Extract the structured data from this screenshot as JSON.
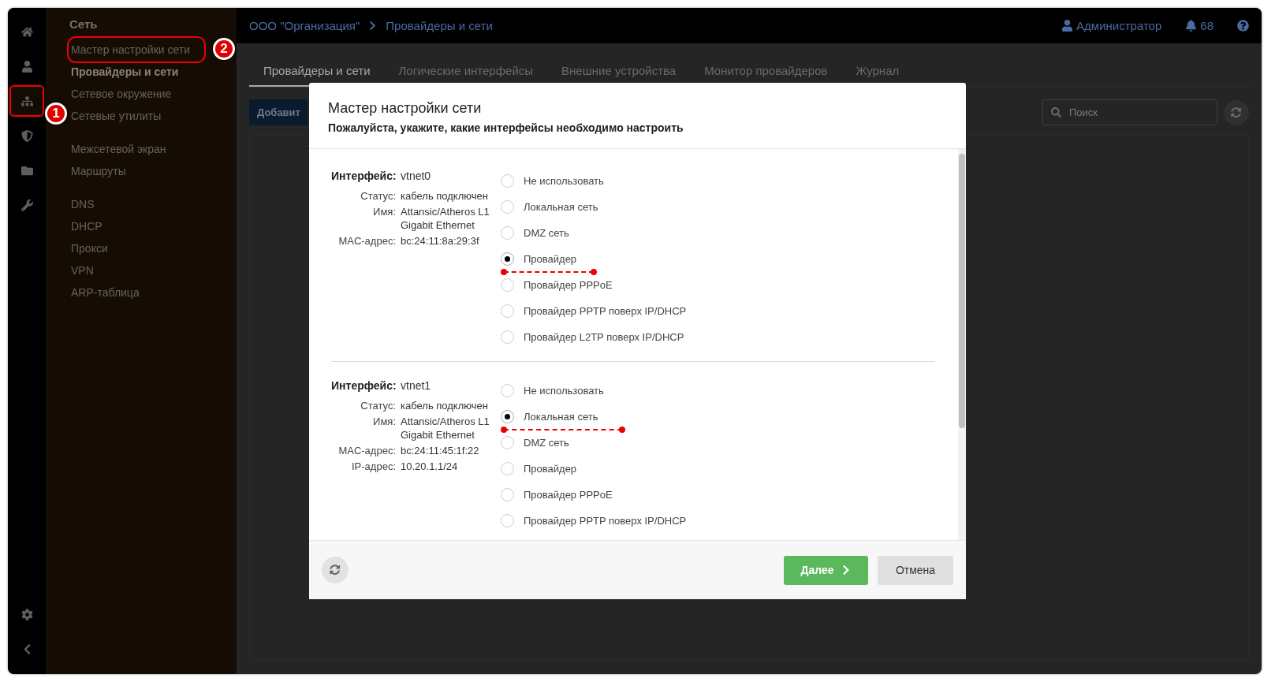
{
  "rail": {
    "items": [
      {
        "selected": false
      },
      {
        "selected": false
      },
      {
        "selected": true,
        "marker": "1"
      },
      {
        "selected": false
      },
      {
        "selected": false
      },
      {
        "selected": false
      }
    ],
    "bottom_items": [
      {
        "selected": false
      },
      {
        "selected": false
      }
    ]
  },
  "sidebar": {
    "title": "Сеть",
    "groups": [
      [
        {
          "label": "Мастер настройки сети",
          "selected": false,
          "marker": "2"
        },
        {
          "label": "Провайдеры и сети",
          "selected": true
        },
        {
          "label": "Сетевое окружение",
          "selected": false
        },
        {
          "label": "Сетевые утилиты",
          "selected": false
        }
      ],
      [
        {
          "label": "Межсетевой экран",
          "selected": false
        },
        {
          "label": "Маршруты",
          "selected": false
        }
      ],
      [
        {
          "label": "DNS",
          "selected": false
        },
        {
          "label": "DHCP",
          "selected": false
        },
        {
          "label": "Прокси",
          "selected": false
        },
        {
          "label": "VPN",
          "selected": false
        },
        {
          "label": "ARP-таблица",
          "selected": false
        }
      ]
    ]
  },
  "topbar": {
    "breadcrumb": [
      "ООО \"Организация\"",
      "Провайдеры и сети"
    ],
    "user": "Администратор",
    "notifications": "68"
  },
  "tabs": [
    {
      "label": "Провайдеры и сети",
      "selected": true
    },
    {
      "label": "Логические интерфейсы",
      "selected": false
    },
    {
      "label": "Внешние устройства",
      "selected": false
    },
    {
      "label": "Монитор провайдеров",
      "selected": false
    },
    {
      "label": "Журнал",
      "selected": false
    }
  ],
  "toolbar": {
    "add_button": "Добавит",
    "search": {
      "placeholder": "Поиск"
    }
  },
  "dialog": {
    "title": "Мастер настройки сети",
    "subtitle": "Пожалуйста, укажите, какие интерфейсы необходимо настроить",
    "interfaces": [
      {
        "fields": [
          {
            "kind": "title",
            "label": "Интерфейс:",
            "value": "vtnet0"
          },
          {
            "kind": "field",
            "label": "Статус:",
            "value": "кабель подключен"
          },
          {
            "kind": "field",
            "label": "Имя:",
            "value": "Attansic/Atheros L1 Gigabit Ethernet"
          },
          {
            "kind": "field",
            "label": "MAC-адрес:",
            "value": "bc:24:11:8a:29:3f"
          }
        ],
        "options": [
          {
            "label": "Не использовать",
            "selected": false,
            "highlight": false
          },
          {
            "label": "Локальная сеть",
            "selected": false,
            "highlight": false
          },
          {
            "label": "DMZ сеть",
            "selected": false,
            "highlight": false
          },
          {
            "label": "Провайдер",
            "selected": true,
            "highlight": true
          },
          {
            "label": "Провайдер PPPoE",
            "selected": false,
            "highlight": false
          },
          {
            "label": "Провайдер PPTP поверх IP/DHCP",
            "selected": false,
            "highlight": false
          },
          {
            "label": "Провайдер L2TP поверх IP/DHCP",
            "selected": false,
            "highlight": false
          }
        ]
      },
      {
        "fields": [
          {
            "kind": "title",
            "label": "Интерфейс:",
            "value": "vtnet1"
          },
          {
            "kind": "field",
            "label": "Статус:",
            "value": "кабель подключен"
          },
          {
            "kind": "field",
            "label": "Имя:",
            "value": "Attansic/Atheros L1 Gigabit Ethernet"
          },
          {
            "kind": "field",
            "label": "MAC-адрес:",
            "value": "bc:24:11:45:1f:22"
          },
          {
            "kind": "field",
            "label": "IP-адрес:",
            "value": "10.20.1.1/24"
          }
        ],
        "options": [
          {
            "label": "Не использовать",
            "selected": false,
            "highlight": false
          },
          {
            "label": "Локальная сеть",
            "selected": true,
            "highlight": true
          },
          {
            "label": "DMZ сеть",
            "selected": false,
            "highlight": false
          },
          {
            "label": "Провайдер",
            "selected": false,
            "highlight": false
          },
          {
            "label": "Провайдер PPPoE",
            "selected": false,
            "highlight": false
          },
          {
            "label": "Провайдер PPTP поверх IP/DHCP",
            "selected": false,
            "highlight": false
          }
        ]
      }
    ],
    "next_button": "Далее",
    "cancel_button": "Отмена"
  }
}
